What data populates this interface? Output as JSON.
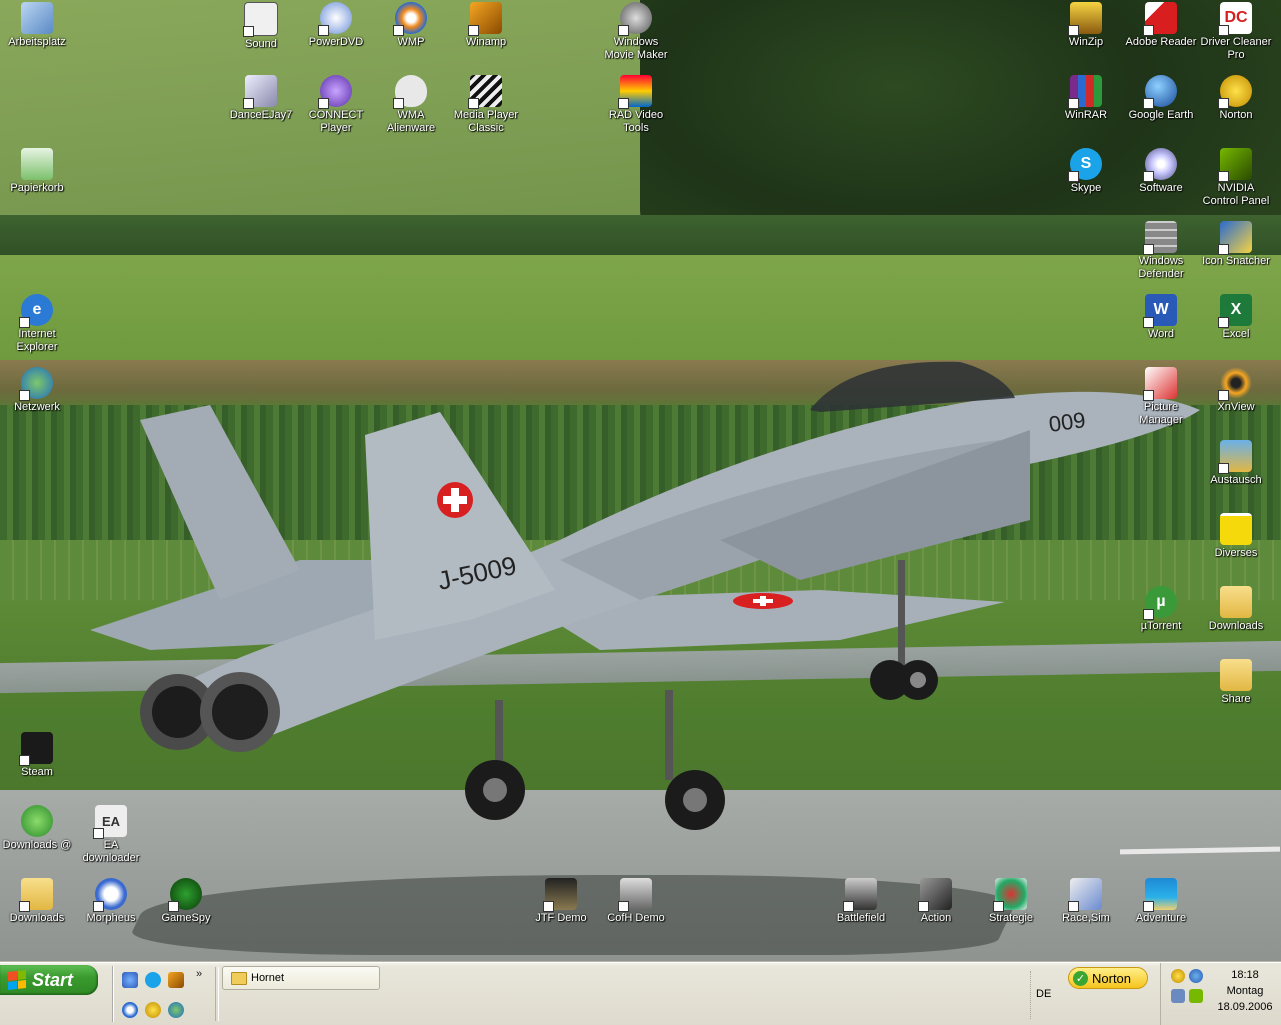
{
  "desktop": {
    "icons": {
      "arbeitsplatz": "Arbeitsplatz",
      "papierkorb": "Papierkorb",
      "ie": "Internet Explorer",
      "netzwerk": "Netzwerk",
      "steam": "Steam",
      "downloads_at": "Downloads @",
      "downloads_bl": "Downloads",
      "sound": "Sound",
      "dancejay": "DanceEJay7",
      "powerdvd": "PowerDVD",
      "connect": "CONNECT Player",
      "wmp": "WMP",
      "wma_alien": "WMA Alienware",
      "winamp": "Winamp",
      "mpc": "Media Player Classic",
      "moviemaker": "Windows Movie Maker",
      "radtools": "RAD Video Tools",
      "ea": "EA downloader",
      "morpheus": "Morpheus",
      "gamespy": "GameSpy",
      "jtf": "JTF Demo",
      "cofh": "CofH Demo",
      "battlefield": "Battlefield",
      "action": "Action",
      "strategie": "Strategie",
      "racesim": "Race,Sim",
      "adventure": "Adventure",
      "winzip": "WinZip",
      "winrar": "WinRAR",
      "skype": "Skype",
      "adobe": "Adobe Reader",
      "gearth": "Google Earth",
      "software": "Software",
      "defender": "Windows Defender",
      "word": "Word",
      "picmgr": "Picture Manager",
      "utorrent": "µTorrent",
      "drivercleaner": "Driver Cleaner Pro",
      "norton": "Norton",
      "nvidia": "NVIDIA Control Panel",
      "iconsnatcher": "Icon Snatcher",
      "excel": "Excel",
      "xnview": "XnView",
      "austausch": "Austausch",
      "diverses": "Diverses",
      "downloads_r": "Downloads",
      "share": "Share"
    },
    "wallpaper": {
      "tail_code": "J-5009",
      "nose_number": "009"
    }
  },
  "taskbar": {
    "start_label": "Start",
    "more_glyph": "»",
    "window_button": "Hornet",
    "language": "DE",
    "norton_label": "Norton",
    "clock": {
      "time": "18:18",
      "day": "Montag",
      "date": "18.09.2006"
    }
  },
  "colors": {
    "taskbar": "#dedbce",
    "start_green": "#3a9a2e",
    "norton_yellow": "#f6c51e"
  }
}
